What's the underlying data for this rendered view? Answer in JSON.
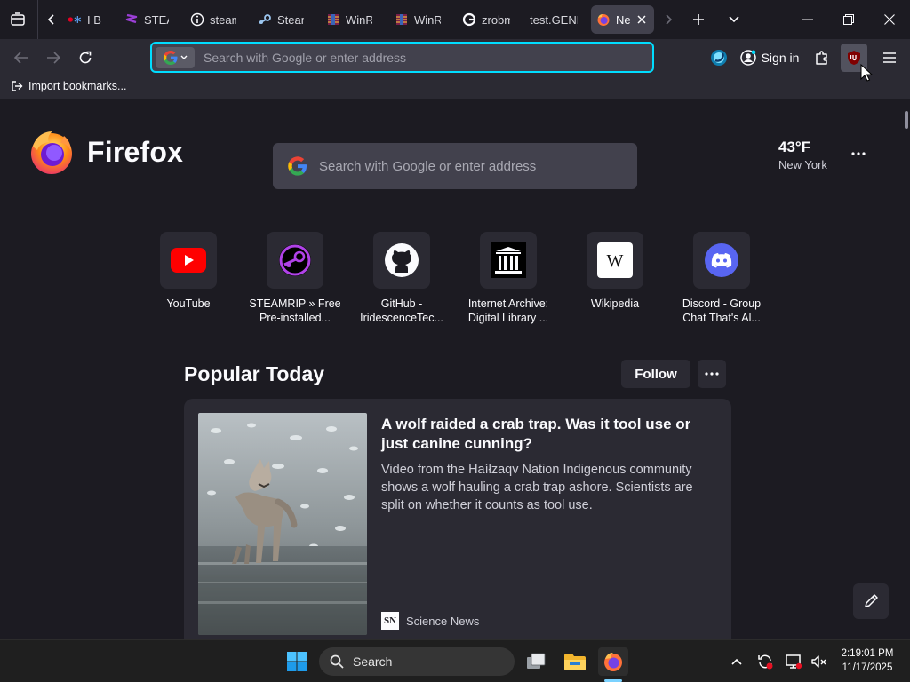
{
  "colors": {
    "accent": "#00ddff",
    "background": "#1c1b22",
    "toolbar": "#2b2a33",
    "tile": "#2b2a33"
  },
  "tabs": [
    {
      "label": "I B",
      "icon": "pinterest-snowflake-icon",
      "active": false
    },
    {
      "label": "STEAM",
      "icon": "steamrip-icon",
      "active": false
    },
    {
      "label": "steam",
      "icon": "info-icon",
      "active": false
    },
    {
      "label": "Steam",
      "icon": "steam-icon",
      "active": false
    },
    {
      "label": "WinRA",
      "icon": "winrar-icon",
      "active": false
    },
    {
      "label": "WinRA",
      "icon": "winrar-icon",
      "active": false
    },
    {
      "label": "zrobm",
      "icon": "google-icon",
      "active": false
    },
    {
      "label": "test.GENE",
      "icon": "",
      "active": false
    },
    {
      "label": "Ne",
      "icon": "firefox-icon",
      "active": true
    }
  ],
  "navbar": {
    "search_placeholder": "Search with Google or enter address",
    "signin_label": "Sign in"
  },
  "bookmarks": {
    "import_label": "Import bookmarks..."
  },
  "newtab": {
    "brand": "Firefox",
    "search_placeholder": "Search with Google or enter address",
    "weather": {
      "temp": "43°F",
      "city": "New York"
    },
    "top_sites": [
      {
        "line1": "YouTube",
        "line2": "",
        "icon": "youtube-icon"
      },
      {
        "line1": "STEAMRIP » Free",
        "line2": "Pre-installed...",
        "icon": "steamrip-icon"
      },
      {
        "line1": "GitHub -",
        "line2": "IridescenceTec...",
        "icon": "github-icon"
      },
      {
        "line1": "Internet Archive:",
        "line2": "Digital Library ...",
        "icon": "internet-archive-icon"
      },
      {
        "line1": "Wikipedia",
        "line2": "",
        "icon": "wikipedia-icon"
      },
      {
        "line1": "Discord - Group",
        "line2": "Chat That's Al...",
        "icon": "discord-icon"
      }
    ],
    "popular": {
      "title": "Popular Today",
      "follow_label": "Follow"
    },
    "story": {
      "title": "A wolf raided a crab trap. Was it tool use or just canine cunning?",
      "excerpt": "Video from the Haíłzaqv Nation Indigenous community shows a wolf hauling a crab trap ashore. Scientists are split on whether it counts as tool use.",
      "source": "Science News",
      "source_logo": "SN"
    }
  },
  "taskbar": {
    "search_label": "Search",
    "time": "2:19:01 PM",
    "date": "11/17/2025"
  }
}
